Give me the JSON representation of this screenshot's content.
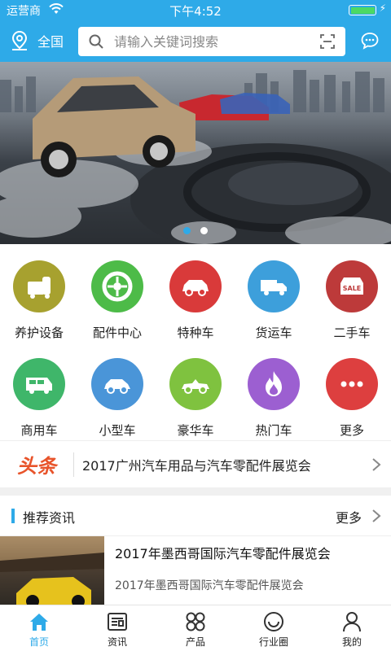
{
  "status": {
    "carrier": "运营商",
    "time": "下午4:52"
  },
  "header": {
    "location": "全国",
    "search_placeholder": "请输入关键词搜索"
  },
  "banner": {
    "slide_count": 2,
    "active_slide": 1
  },
  "categories": [
    {
      "label": "养护设备",
      "color": "#a7a12f",
      "icon": "maintenance-icon"
    },
    {
      "label": "配件中心",
      "color": "#4dbb48",
      "icon": "tire-icon"
    },
    {
      "label": "特种车",
      "color": "#d93a3a",
      "icon": "suv-icon"
    },
    {
      "label": "货运车",
      "color": "#3d9fdb",
      "icon": "truck-icon"
    },
    {
      "label": "二手车",
      "color": "#bd3a3a",
      "icon": "sale-icon"
    },
    {
      "label": "商用车",
      "color": "#3fb66a",
      "icon": "van-icon"
    },
    {
      "label": "小型车",
      "color": "#4a95d8",
      "icon": "compact-car-icon"
    },
    {
      "label": "豪华车",
      "color": "#7fc23f",
      "icon": "convertible-icon"
    },
    {
      "label": "热门车",
      "color": "#9c5fd1",
      "icon": "fire-icon"
    },
    {
      "label": "更多",
      "color": "#dd3f3f",
      "icon": "more-icon"
    }
  ],
  "headline": {
    "tag": "头条",
    "text": "2017广州汽车用品与汽车零配件展览会"
  },
  "recommend": {
    "title": "推荐资讯",
    "more": "更多",
    "articles": [
      {
        "title": "2017年墨西哥国际汽车零配件展览会",
        "subtitle": "2017年墨西哥国际汽车零配件展览会"
      }
    ]
  },
  "tabs": [
    {
      "label": "首页",
      "icon": "home-icon",
      "active": true
    },
    {
      "label": "资讯",
      "icon": "news-icon",
      "active": false
    },
    {
      "label": "产品",
      "icon": "products-icon",
      "active": false
    },
    {
      "label": "行业圈",
      "icon": "circle-icon",
      "active": false
    },
    {
      "label": "我的",
      "icon": "user-icon",
      "active": false
    }
  ],
  "colors": {
    "accent": "#2eaae8",
    "headline_red": "#e8542b"
  }
}
